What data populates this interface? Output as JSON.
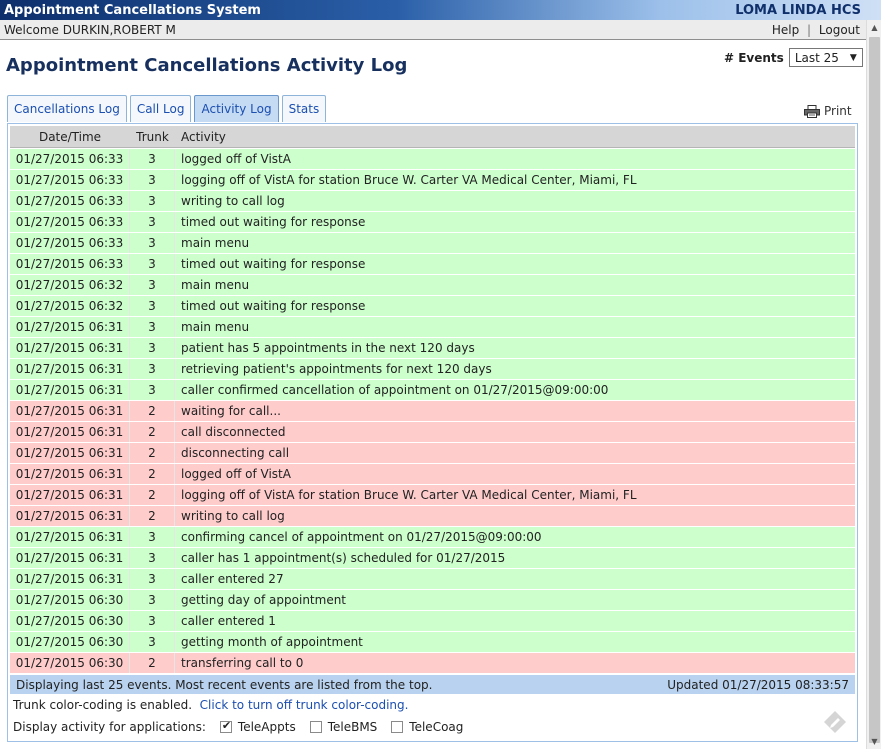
{
  "titlebar": {
    "app_title": "Appointment Cancellations System",
    "org_name": "LOMA LINDA HCS"
  },
  "user_bar": {
    "welcome": "Welcome DURKIN,ROBERT M",
    "help": "Help",
    "sep": "|",
    "logout": "Logout"
  },
  "page": {
    "title": "Appointment Cancellations Activity Log"
  },
  "events": {
    "label": "# Events",
    "selected": "Last 25"
  },
  "tabs": [
    {
      "label": "Cancellations Log"
    },
    {
      "label": "Call Log"
    },
    {
      "label": "Activity Log",
      "active": true
    },
    {
      "label": "Stats"
    }
  ],
  "print_label": "Print",
  "table": {
    "headers": {
      "datetime": "Date/Time",
      "trunk": "Trunk",
      "activity": "Activity"
    },
    "rows": [
      {
        "datetime": "01/27/2015 06:33",
        "trunk": "3",
        "activity": "logged off of VistA"
      },
      {
        "datetime": "01/27/2015 06:33",
        "trunk": "3",
        "activity": "logging off of VistA for station Bruce W. Carter VA Medical Center, Miami, FL"
      },
      {
        "datetime": "01/27/2015 06:33",
        "trunk": "3",
        "activity": "writing to call log"
      },
      {
        "datetime": "01/27/2015 06:33",
        "trunk": "3",
        "activity": "timed out waiting for response"
      },
      {
        "datetime": "01/27/2015 06:33",
        "trunk": "3",
        "activity": "main menu"
      },
      {
        "datetime": "01/27/2015 06:33",
        "trunk": "3",
        "activity": "timed out waiting for response"
      },
      {
        "datetime": "01/27/2015 06:32",
        "trunk": "3",
        "activity": "main menu"
      },
      {
        "datetime": "01/27/2015 06:32",
        "trunk": "3",
        "activity": "timed out waiting for response"
      },
      {
        "datetime": "01/27/2015 06:31",
        "trunk": "3",
        "activity": "main menu"
      },
      {
        "datetime": "01/27/2015 06:31",
        "trunk": "3",
        "activity": "patient has 5 appointments in the next 120 days"
      },
      {
        "datetime": "01/27/2015 06:31",
        "trunk": "3",
        "activity": "retrieving patient's appointments for next 120 days"
      },
      {
        "datetime": "01/27/2015 06:31",
        "trunk": "3",
        "activity": "caller confirmed cancellation of appointment on 01/27/2015@09:00:00"
      },
      {
        "datetime": "01/27/2015 06:31",
        "trunk": "2",
        "activity": "waiting for call..."
      },
      {
        "datetime": "01/27/2015 06:31",
        "trunk": "2",
        "activity": "call disconnected"
      },
      {
        "datetime": "01/27/2015 06:31",
        "trunk": "2",
        "activity": "disconnecting call"
      },
      {
        "datetime": "01/27/2015 06:31",
        "trunk": "2",
        "activity": "logged off of VistA"
      },
      {
        "datetime": "01/27/2015 06:31",
        "trunk": "2",
        "activity": "logging off of VistA for station Bruce W. Carter VA Medical Center, Miami, FL"
      },
      {
        "datetime": "01/27/2015 06:31",
        "trunk": "2",
        "activity": "writing to call log"
      },
      {
        "datetime": "01/27/2015 06:31",
        "trunk": "3",
        "activity": "confirming cancel of appointment on 01/27/2015@09:00:00"
      },
      {
        "datetime": "01/27/2015 06:31",
        "trunk": "3",
        "activity": "caller has 1 appointment(s) scheduled for 01/27/2015"
      },
      {
        "datetime": "01/27/2015 06:31",
        "trunk": "3",
        "activity": "caller entered 27"
      },
      {
        "datetime": "01/27/2015 06:30",
        "trunk": "3",
        "activity": "getting day of appointment"
      },
      {
        "datetime": "01/27/2015 06:30",
        "trunk": "3",
        "activity": "caller entered 1"
      },
      {
        "datetime": "01/27/2015 06:30",
        "trunk": "3",
        "activity": "getting month of appointment"
      },
      {
        "datetime": "01/27/2015 06:30",
        "trunk": "2",
        "activity": "transferring call to 0"
      }
    ]
  },
  "status": {
    "left": "Displaying last 25 events.  Most recent events are listed from the top.",
    "right": "Updated 01/27/2015 08:33:57"
  },
  "color_coding": {
    "text": "Trunk color-coding is enabled.",
    "toggle_link": "Click to turn off trunk color-coding."
  },
  "apps_filter": {
    "label": "Display activity for applications:",
    "options": [
      {
        "label": "TeleAppts",
        "checked": true
      },
      {
        "label": "TeleBMS",
        "checked": false
      },
      {
        "label": "TeleCoag",
        "checked": false
      }
    ]
  },
  "colors": {
    "trunk3_row": "#ccffcc",
    "trunk2_row": "#ffcccc",
    "status_bar": "#b8d2ef",
    "tab_active": "#c5daf3"
  }
}
